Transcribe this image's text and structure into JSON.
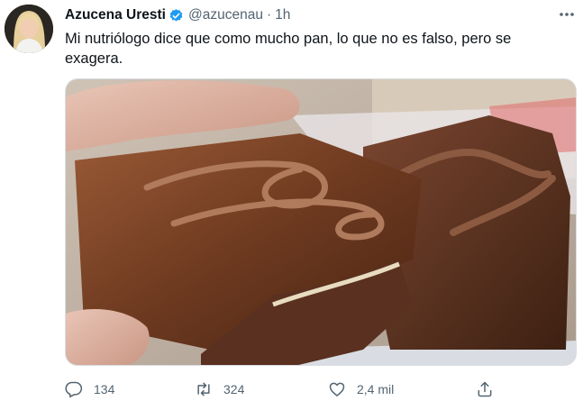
{
  "tweet": {
    "author_name": "Azucena Uresti",
    "handle": "@azucenau",
    "separator": "·",
    "time": "1h",
    "text": "Mi nutriólogo dice que como mucho pan, lo que no es falso, pero se exagera.",
    "verified": true
  },
  "actions": {
    "replies": "134",
    "retweets": "324",
    "likes": "2,4 mil"
  },
  "colors": {
    "text": "#0f1419",
    "secondary": "#536471",
    "verified": "#1d9bf0"
  },
  "icons": [
    "more-icon",
    "verified-icon",
    "reply-icon",
    "retweet-icon",
    "like-icon",
    "share-icon"
  ]
}
